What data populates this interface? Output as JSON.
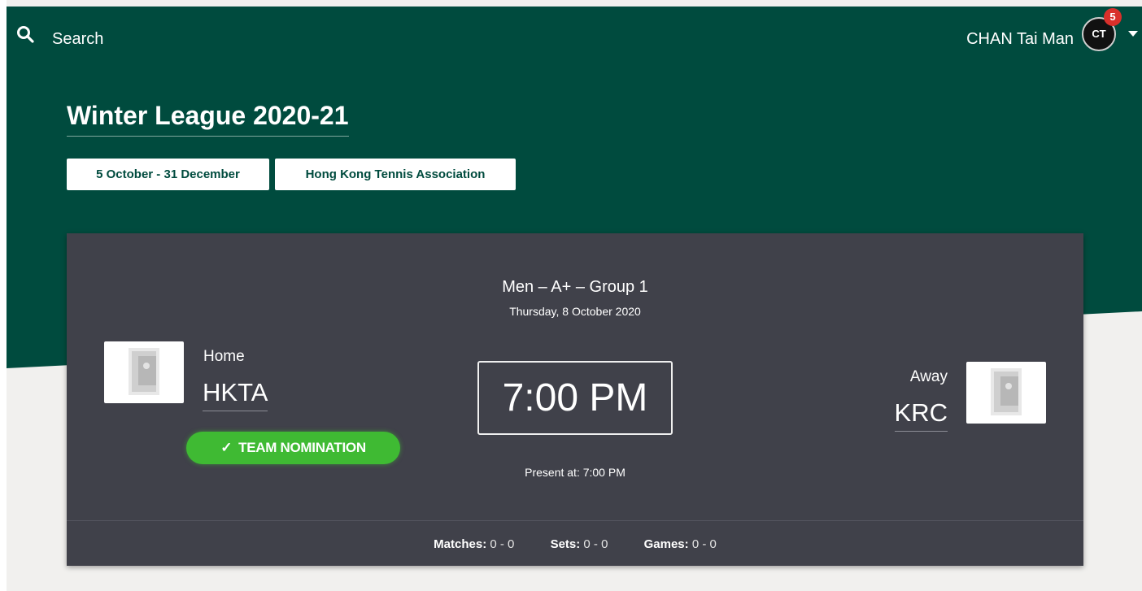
{
  "header": {
    "search_label": "Search",
    "user_name": "CHAN Tai Man",
    "avatar_initials": "CT",
    "notification_count": "5"
  },
  "event": {
    "title": "Winter League 2020-21",
    "date_range": "5 October - 31 December",
    "organizer": "Hong Kong Tennis Association"
  },
  "match": {
    "division": "Men – A+ – Group 1",
    "date": "Thursday, 8 October 2020",
    "time": "7:00 PM",
    "present_at": "Present at: 7:00 PM",
    "home": {
      "label": "Home",
      "team": "HKTA"
    },
    "away": {
      "label": "Away",
      "team": "KRC"
    },
    "nomination_label": "TEAM NOMINATION",
    "stats": {
      "matches_label": "Matches:",
      "matches_value": "0 - 0",
      "sets_label": "Sets:",
      "sets_value": "0 - 0",
      "games_label": "Games:",
      "games_value": "0 - 0"
    }
  },
  "colors": {
    "header_green": "#004b3e",
    "card_bg": "#40414a",
    "nomination_green": "#3fba33",
    "badge_red": "#d9302b"
  }
}
